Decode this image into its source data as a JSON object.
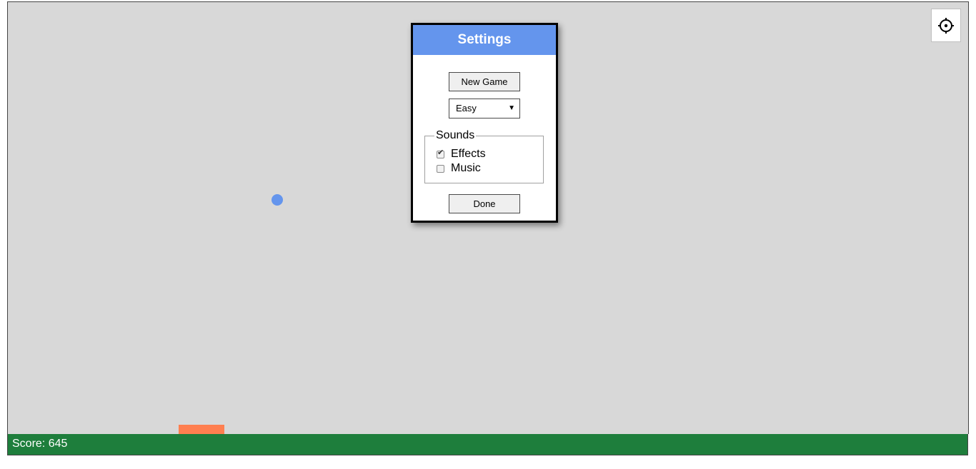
{
  "game": {
    "score_text": "Score: 645",
    "ball_color": "#6495ED",
    "paddle_color": "#FF7F50",
    "field_color": "#D8D8D8",
    "ground_color": "#1E7E3C"
  },
  "settings_button": {
    "icon": "gear-icon"
  },
  "dialog": {
    "title": "Settings",
    "header_color": "#6495ED",
    "new_game_label": "New Game",
    "difficulty": {
      "selected": "Easy"
    },
    "sounds": {
      "legend": "Sounds",
      "effects_label": "Effects",
      "effects_checked": true,
      "music_label": "Music",
      "music_checked": false
    },
    "done_label": "Done"
  }
}
